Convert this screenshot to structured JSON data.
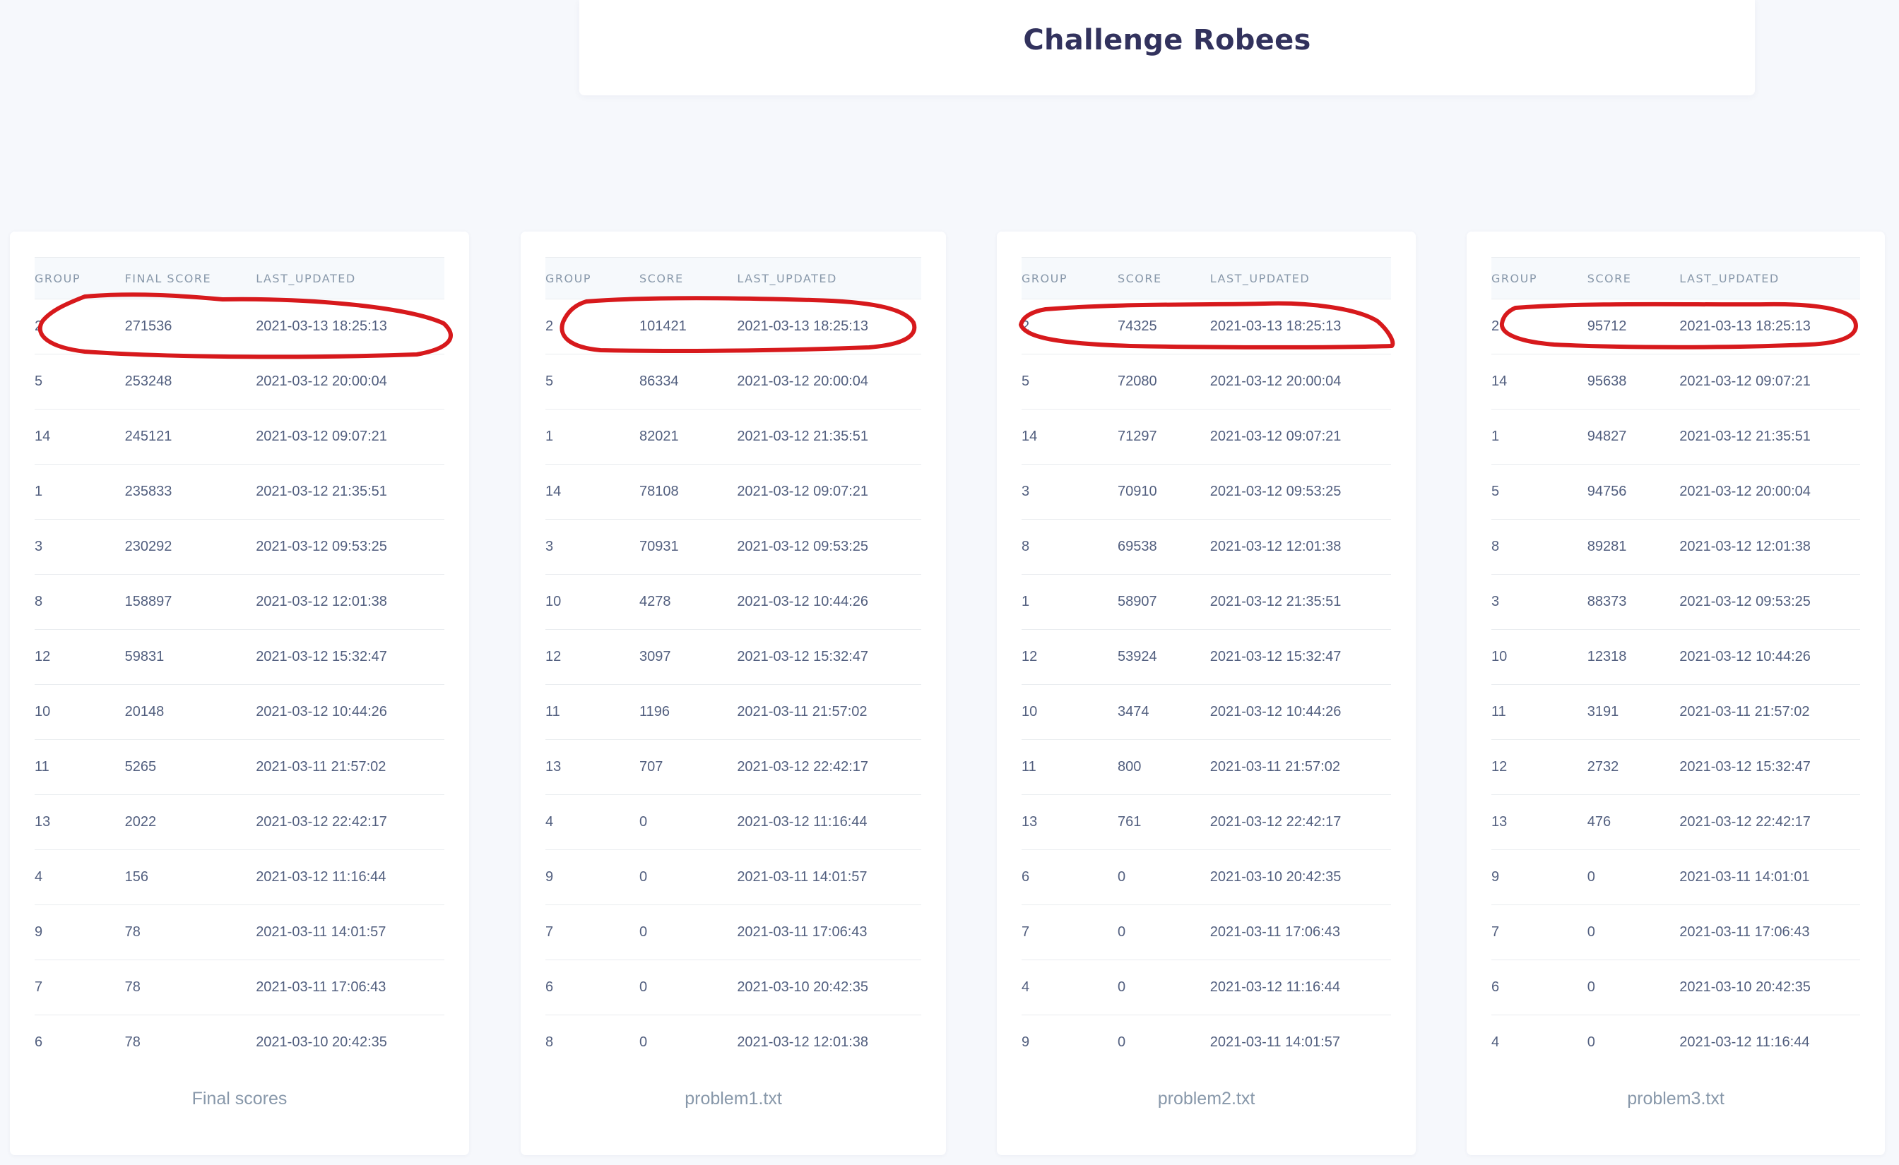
{
  "page": {
    "title": "Challenge Robees"
  },
  "colors": {
    "background": "#f6f8fc",
    "card": "#ffffff",
    "annotation": "#d7191c"
  },
  "tables": [
    {
      "footer": "Final scores",
      "columns": [
        "GROUP",
        "FINAL SCORE",
        "LAST_UPDATED"
      ],
      "rows": [
        [
          "2",
          "271536",
          "2021-03-13 18:25:13"
        ],
        [
          "5",
          "253248",
          "2021-03-12 20:00:04"
        ],
        [
          "14",
          "245121",
          "2021-03-12 09:07:21"
        ],
        [
          "1",
          "235833",
          "2021-03-12 21:35:51"
        ],
        [
          "3",
          "230292",
          "2021-03-12 09:53:25"
        ],
        [
          "8",
          "158897",
          "2021-03-12 12:01:38"
        ],
        [
          "12",
          "59831",
          "2021-03-12 15:32:47"
        ],
        [
          "10",
          "20148",
          "2021-03-12 10:44:26"
        ],
        [
          "11",
          "5265",
          "2021-03-11 21:57:02"
        ],
        [
          "13",
          "2022",
          "2021-03-12 22:42:17"
        ],
        [
          "4",
          "156",
          "2021-03-12 11:16:44"
        ],
        [
          "9",
          "78",
          "2021-03-11 14:01:57"
        ],
        [
          "7",
          "78",
          "2021-03-11 17:06:43"
        ],
        [
          "6",
          "78",
          "2021-03-10 20:42:35"
        ]
      ]
    },
    {
      "footer": "problem1.txt",
      "columns": [
        "GROUP",
        "SCORE",
        "LAST_UPDATED"
      ],
      "rows": [
        [
          "2",
          "101421",
          "2021-03-13 18:25:13"
        ],
        [
          "5",
          "86334",
          "2021-03-12 20:00:04"
        ],
        [
          "1",
          "82021",
          "2021-03-12 21:35:51"
        ],
        [
          "14",
          "78108",
          "2021-03-12 09:07:21"
        ],
        [
          "3",
          "70931",
          "2021-03-12 09:53:25"
        ],
        [
          "10",
          "4278",
          "2021-03-12 10:44:26"
        ],
        [
          "12",
          "3097",
          "2021-03-12 15:32:47"
        ],
        [
          "11",
          "1196",
          "2021-03-11 21:57:02"
        ],
        [
          "13",
          "707",
          "2021-03-12 22:42:17"
        ],
        [
          "4",
          "0",
          "2021-03-12 11:16:44"
        ],
        [
          "9",
          "0",
          "2021-03-11 14:01:57"
        ],
        [
          "7",
          "0",
          "2021-03-11 17:06:43"
        ],
        [
          "6",
          "0",
          "2021-03-10 20:42:35"
        ],
        [
          "8",
          "0",
          "2021-03-12 12:01:38"
        ]
      ]
    },
    {
      "footer": "problem2.txt",
      "columns": [
        "GROUP",
        "SCORE",
        "LAST_UPDATED"
      ],
      "rows": [
        [
          "2",
          "74325",
          "2021-03-13 18:25:13"
        ],
        [
          "5",
          "72080",
          "2021-03-12 20:00:04"
        ],
        [
          "14",
          "71297",
          "2021-03-12 09:07:21"
        ],
        [
          "3",
          "70910",
          "2021-03-12 09:53:25"
        ],
        [
          "8",
          "69538",
          "2021-03-12 12:01:38"
        ],
        [
          "1",
          "58907",
          "2021-03-12 21:35:51"
        ],
        [
          "12",
          "53924",
          "2021-03-12 15:32:47"
        ],
        [
          "10",
          "3474",
          "2021-03-12 10:44:26"
        ],
        [
          "11",
          "800",
          "2021-03-11 21:57:02"
        ],
        [
          "13",
          "761",
          "2021-03-12 22:42:17"
        ],
        [
          "6",
          "0",
          "2021-03-10 20:42:35"
        ],
        [
          "7",
          "0",
          "2021-03-11 17:06:43"
        ],
        [
          "4",
          "0",
          "2021-03-12 11:16:44"
        ],
        [
          "9",
          "0",
          "2021-03-11 14:01:57"
        ]
      ]
    },
    {
      "footer": "problem3.txt",
      "columns": [
        "GROUP",
        "SCORE",
        "LAST_UPDATED"
      ],
      "rows": [
        [
          "2",
          "95712",
          "2021-03-13 18:25:13"
        ],
        [
          "14",
          "95638",
          "2021-03-12 09:07:21"
        ],
        [
          "1",
          "94827",
          "2021-03-12 21:35:51"
        ],
        [
          "5",
          "94756",
          "2021-03-12 20:00:04"
        ],
        [
          "8",
          "89281",
          "2021-03-12 12:01:38"
        ],
        [
          "3",
          "88373",
          "2021-03-12 09:53:25"
        ],
        [
          "10",
          "12318",
          "2021-03-12 10:44:26"
        ],
        [
          "11",
          "3191",
          "2021-03-11 21:57:02"
        ],
        [
          "12",
          "2732",
          "2021-03-12 15:32:47"
        ],
        [
          "13",
          "476",
          "2021-03-12 22:42:17"
        ],
        [
          "9",
          "0",
          "2021-03-11 14:01:01"
        ],
        [
          "7",
          "0",
          "2021-03-11 17:06:43"
        ],
        [
          "6",
          "0",
          "2021-03-10 20:42:35"
        ],
        [
          "4",
          "0",
          "2021-03-12 11:16:44"
        ]
      ]
    }
  ]
}
